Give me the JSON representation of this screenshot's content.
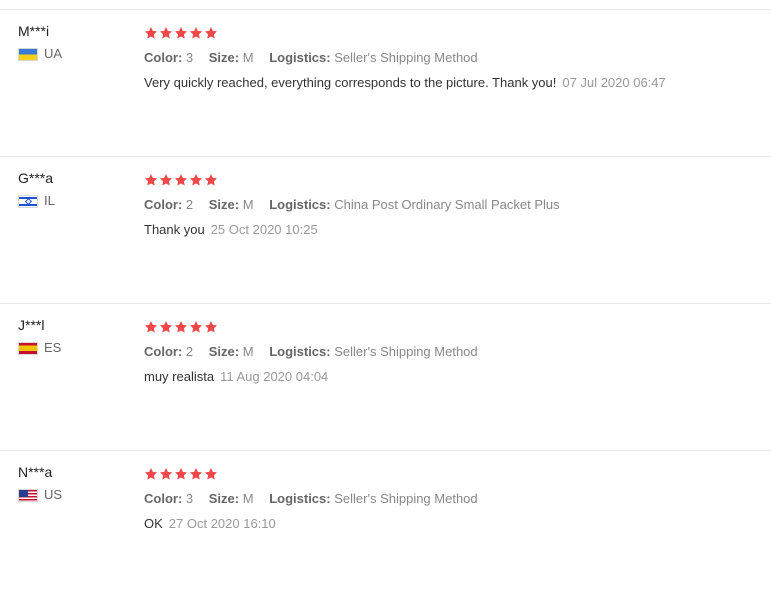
{
  "labels": {
    "color": "Color:",
    "size": "Size:",
    "logistics": "Logistics:"
  },
  "star_color": "#f04848",
  "reviews": [
    {
      "user": "M***i",
      "country": "UA",
      "rating": 5,
      "color": "3",
      "size": "M",
      "logistics": "Seller's Shipping Method",
      "text": "Very quickly reached, everything corresponds to the picture. Thank you!",
      "date": "07 Jul 2020 06:47"
    },
    {
      "user": "G***a",
      "country": "IL",
      "rating": 5,
      "color": "2",
      "size": "M",
      "logistics": "China Post Ordinary Small Packet Plus",
      "text": "Thank you",
      "date": "25 Oct 2020 10:25"
    },
    {
      "user": "J***l",
      "country": "ES",
      "rating": 5,
      "color": "2",
      "size": "M",
      "logistics": "Seller's Shipping Method",
      "text": "muy realista",
      "date": "11 Aug 2020 04:04"
    },
    {
      "user": "N***a",
      "country": "US",
      "rating": 5,
      "color": "3",
      "size": "M",
      "logistics": "Seller's Shipping Method",
      "text": "OK",
      "date": "27 Oct 2020 16:10"
    }
  ]
}
